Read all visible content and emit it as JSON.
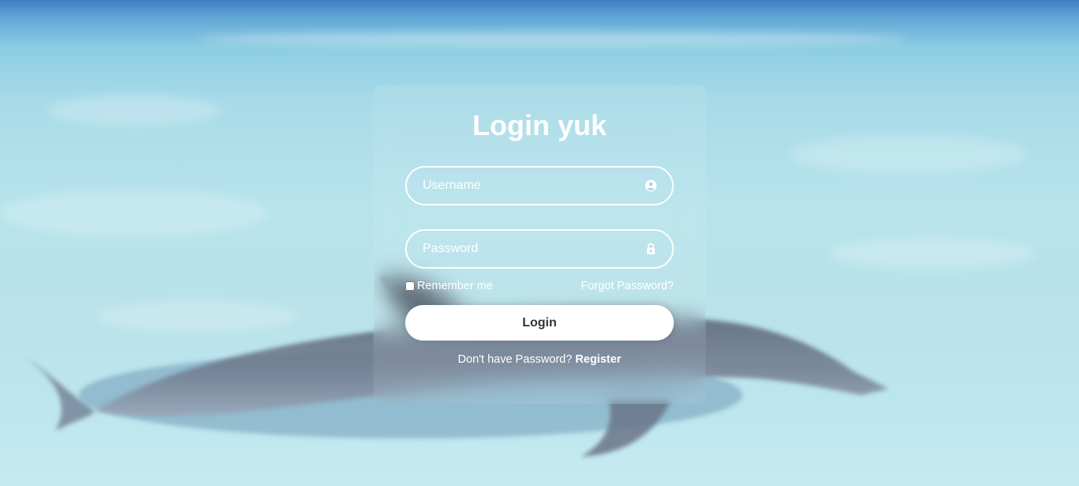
{
  "background": {
    "scene": "ocean with dolphin"
  },
  "login": {
    "title": "Login yuk",
    "username_placeholder": "Username",
    "password_placeholder": "Password",
    "remember_label": "Remember me",
    "forgot_label": "Forgot Password?",
    "login_button": "Login",
    "register_prompt": "Don't have Password?",
    "register_link": "Register"
  },
  "icons": {
    "username": "user-circle-icon",
    "password": "lock-icon"
  },
  "colors": {
    "text": "#ffffff",
    "button_bg": "#ffffff",
    "button_text": "#333333"
  }
}
